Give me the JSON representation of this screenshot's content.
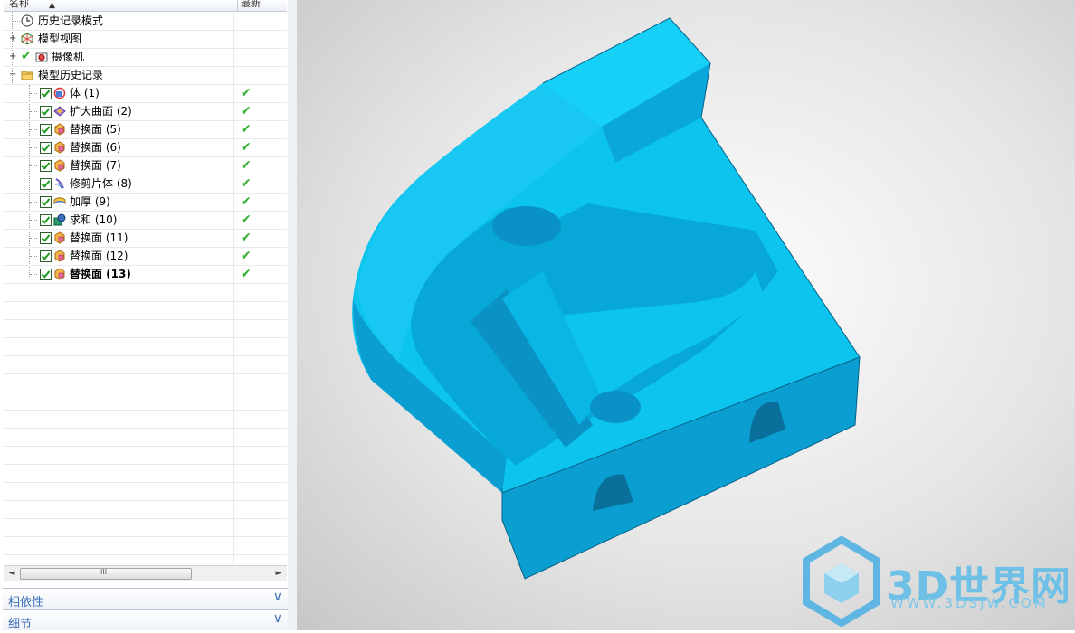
{
  "navigator": {
    "columns": {
      "name": "名称",
      "latest": "最新"
    },
    "tree": [
      {
        "label": "历史记录模式",
        "icon": "clock-icon"
      },
      {
        "label": "模型视图",
        "icon": "model-view-icon"
      },
      {
        "label": "摄像机",
        "icon": "camera-icon"
      },
      {
        "label": "模型历史记录",
        "icon": "folder-icon"
      },
      {
        "label": "体 (1)",
        "icon": "body-feature-icon",
        "latest": "✔"
      },
      {
        "label": "扩大曲面 (2)",
        "icon": "enlarge-surface-icon",
        "latest": "✔"
      },
      {
        "label": "替换面 (5)",
        "icon": "replace-face-icon",
        "latest": "✔"
      },
      {
        "label": "替换面 (6)",
        "icon": "replace-face-icon",
        "latest": "✔"
      },
      {
        "label": "替换面 (7)",
        "icon": "replace-face-icon",
        "latest": "✔"
      },
      {
        "label": "修剪片体 (8)",
        "icon": "trim-sheet-icon",
        "latest": "✔"
      },
      {
        "label": "加厚 (9)",
        "icon": "thicken-icon",
        "latest": "✔"
      },
      {
        "label": "求和 (10)",
        "icon": "unite-icon",
        "latest": "✔"
      },
      {
        "label": "替换面 (11)",
        "icon": "replace-face-icon",
        "latest": "✔"
      },
      {
        "label": "替换面 (12)",
        "icon": "replace-face-icon",
        "latest": "✔"
      },
      {
        "label": "替换面 (13)",
        "icon": "replace-face-icon",
        "latest": "✔"
      }
    ],
    "scrollbar": {
      "thumb_grip": "III",
      "left_arrow": "◄",
      "right_arrow": "►"
    },
    "panels": [
      {
        "label": "相依性"
      },
      {
        "label": "细节"
      }
    ]
  },
  "watermark": {
    "brand": "3D世界网",
    "url": "WWW.3DSJW.COM"
  },
  "colors": {
    "part": "#0cc4ee",
    "part_dark": "#0a8fc0",
    "accent": "#3b6fb6",
    "check": "#2fae2f"
  }
}
